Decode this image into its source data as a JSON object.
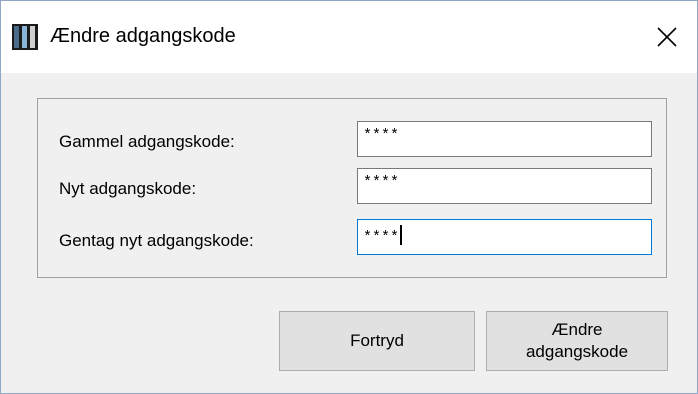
{
  "window": {
    "title": "Ændre adgangskode",
    "icon": "app-icon",
    "close_icon": "close-icon"
  },
  "form": {
    "fields": [
      {
        "label": "Gammel adgangskode:",
        "value": "****"
      },
      {
        "label": "Nyt adgangskode:",
        "value": "****"
      },
      {
        "label": "Gentag nyt adgangskode:",
        "value": "****"
      }
    ]
  },
  "buttons": {
    "cancel_label": "Fortryd",
    "submit_label_line1": "Ændre",
    "submit_label_line2": "adgangskode"
  }
}
